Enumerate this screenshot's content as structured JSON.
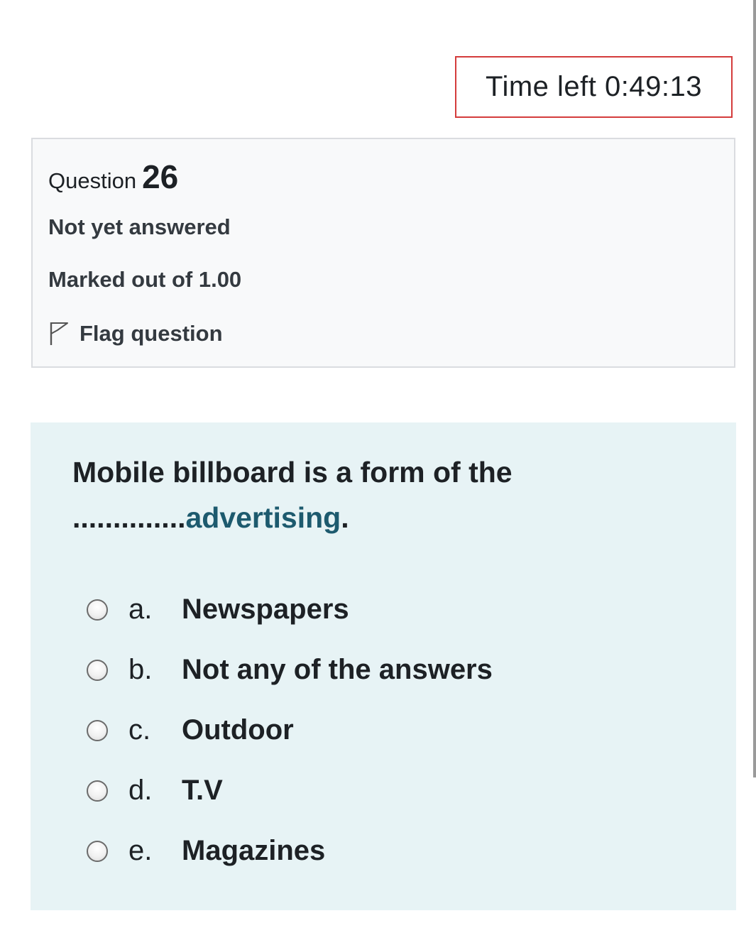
{
  "timer": {
    "text": "Time left 0:49:13"
  },
  "info": {
    "question_label": "Question",
    "question_number": "26",
    "status": "Not yet answered",
    "marks": "Marked out of 1.00",
    "flag_label": "Flag question",
    "flag_icon": "flag-outline-icon"
  },
  "question": {
    "text_line1": "Mobile billboard is a form of the",
    "blank": "..............",
    "text_accent": "advertising",
    "text_end": "."
  },
  "options": [
    {
      "letter": "a.",
      "label": "Newspapers"
    },
    {
      "letter": "b.",
      "label": "Not any of the answers"
    },
    {
      "letter": "c.",
      "label": "Outdoor"
    },
    {
      "letter": "d.",
      "label": "T.V"
    },
    {
      "letter": "e.",
      "label": "Magazines"
    }
  ],
  "colors": {
    "timer_border": "#d43c3c",
    "info_bg": "#f8f9fa",
    "question_bg": "#e7f3f5",
    "accent_text": "#1d5a6e"
  }
}
